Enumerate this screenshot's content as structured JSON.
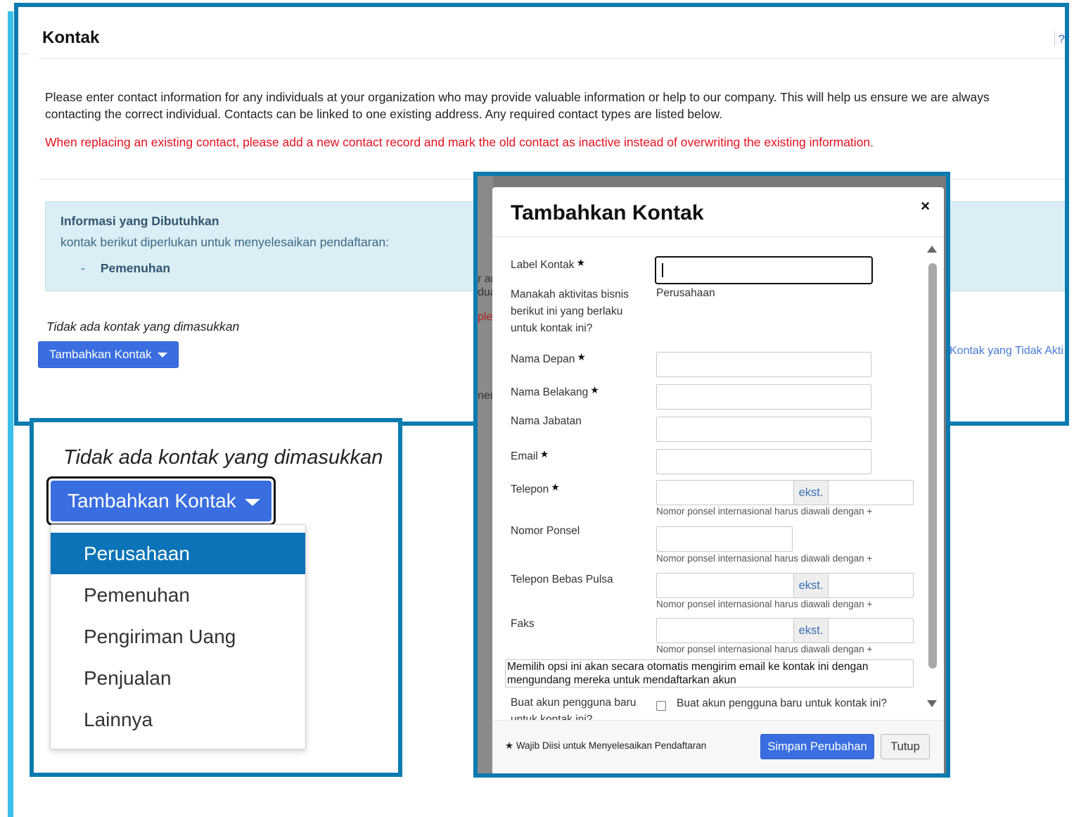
{
  "page": {
    "title": "Kontak",
    "help_glyph": "?",
    "intro": "Please enter contact information for any individuals at your organization who may provide valuable information or help to our company. This will help us ensure we are always contacting the correct individual. Contacts can be linked to one existing address. Any required contact types are listed below.",
    "warning": "When replacing an existing contact, please add a new contact record and mark the old contact as inactive instead of overwriting the existing information.",
    "info_box": {
      "heading": "Informasi yang Dibutuhkan",
      "body": "kontak berikut diperlukan untuk menyelesaikan pendaftaran:",
      "items": [
        {
          "dash": "-",
          "label": "Pemenuhan"
        }
      ]
    },
    "empty_text": "Tidak ada kontak yang dimasukkan",
    "add_button": "Tambahkan Kontak",
    "inactive_link": "Kontak yang Tidak Akti",
    "colors": {
      "frame": "#0b7bb0",
      "primary_button": "#3a6ee0",
      "warning": "#e4111f",
      "info_bg": "#dbeef5",
      "menu_active": "#0b74b8"
    }
  },
  "dropdown_zoom": {
    "empty_text": "Tidak ada kontak yang dimasukkan",
    "button": "Tambahkan Kontak",
    "options": [
      "Perusahaan",
      "Pemenuhan",
      "Pengiriman Uang",
      "Penjualan",
      "Lainnya"
    ],
    "selected": "Perusahaan"
  },
  "background_fragments": {
    "a": "r ar",
    "b": "dua",
    "c": "ple",
    "d": "ner"
  },
  "modal": {
    "title": "Tambahkan Kontak",
    "close_glyph": "×",
    "required_mark": "★",
    "fields": {
      "label_kontak": {
        "label": "Label Kontak",
        "value": ""
      },
      "activity": {
        "label": "Manakah aktivitas bisnis berikut ini yang berlaku untuk kontak ini?",
        "value": "Perusahaan"
      },
      "first_name": {
        "label": "Nama Depan",
        "value": ""
      },
      "last_name": {
        "label": "Nama Belakang",
        "value": ""
      },
      "job_title": {
        "label": "Nama Jabatan",
        "value": ""
      },
      "email": {
        "label": "Email",
        "value": ""
      },
      "phone": {
        "label": "Telepon",
        "ext": "ekst.",
        "hint": "Nomor ponsel internasional harus diawali dengan +"
      },
      "mobile": {
        "label": "Nomor Ponsel",
        "hint": "Nomor ponsel internasional harus diawali dengan +"
      },
      "toll_free": {
        "label": "Telepon Bebas Pulsa",
        "ext": "ekst.",
        "hint": "Nomor ponsel internasional harus diawali dengan +"
      },
      "fax": {
        "label": "Faks",
        "ext": "ekst.",
        "hint": "Nomor ponsel internasional harus diawali dengan +"
      }
    },
    "tip": "Memilih opsi ini akan secara otomatis mengirim email ke kontak ini dengan mengundang mereka untuk mendaftarkan akun",
    "new_account": {
      "label": "Buat akun pengguna baru untuk kontak ini?",
      "checkbox_label": "Buat akun pengguna baru untuk kontak ini?",
      "checked": false
    },
    "footer_note": "Wajib Diisi untuk Menyelesaikan Pendaftaran",
    "save_button": "Simpan Perubahan",
    "close_button": "Tutup"
  }
}
